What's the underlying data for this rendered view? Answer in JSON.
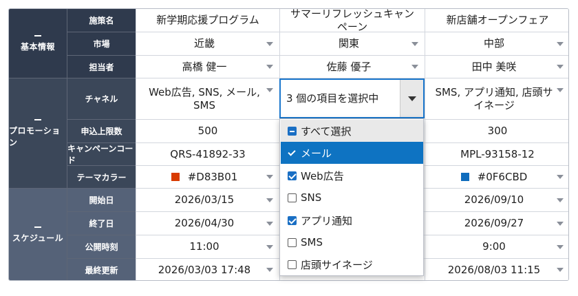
{
  "groups": [
    {
      "label": "基本情報",
      "color": "#2f3a4d"
    },
    {
      "label": "プロモーション",
      "color": "#3b4759"
    },
    {
      "label": "スケジュール",
      "color": "#556278"
    }
  ],
  "fields": [
    "施策名",
    "市場",
    "担当者",
    "チャネル",
    "申込上限数",
    "キャンペーンコード",
    "テーマカラー",
    "開始日",
    "終了日",
    "公開時刻",
    "最終更新"
  ],
  "columns": [
    {
      "values": [
        "新学期応援プログラム",
        "近畿",
        "高橋 健一",
        "Web広告, SNS, メール, SMS",
        "500",
        "QRS-41892-33",
        "#D83B01",
        "2026/03/15",
        "2026/04/30",
        "11:00",
        "2026/03/03 17:48"
      ],
      "swatch": "#D83B01"
    },
    {
      "values": [
        "サマーリフレッシュキャンペーン",
        "関東",
        "佐藤 優子",
        "",
        "",
        "",
        "",
        "",
        "",
        "",
        ""
      ],
      "swatch": ""
    },
    {
      "values": [
        "新店舗オープンフェア",
        "中部",
        "田中 美咲",
        "SMS, アプリ通知, 店頭サイネージ",
        "300",
        "MPL-93158-12",
        "#0F6CBD",
        "2026/09/10",
        "2026/09/27",
        "9:00",
        "2026/08/03 11:15"
      ],
      "swatch": "#0F6CBD"
    }
  ],
  "editor": {
    "text": "3 個の項目を選択中"
  },
  "dropdown": {
    "options": [
      {
        "label": "すべて選択",
        "state": "indeterminate"
      },
      {
        "label": "メール",
        "state": "checked",
        "highlighted": true
      },
      {
        "label": "Web広告",
        "state": "checked"
      },
      {
        "label": "SNS",
        "state": "unchecked"
      },
      {
        "label": "アプリ通知",
        "state": "checked"
      },
      {
        "label": "SMS",
        "state": "unchecked"
      },
      {
        "label": "店頭サイネージ",
        "state": "unchecked"
      }
    ]
  }
}
